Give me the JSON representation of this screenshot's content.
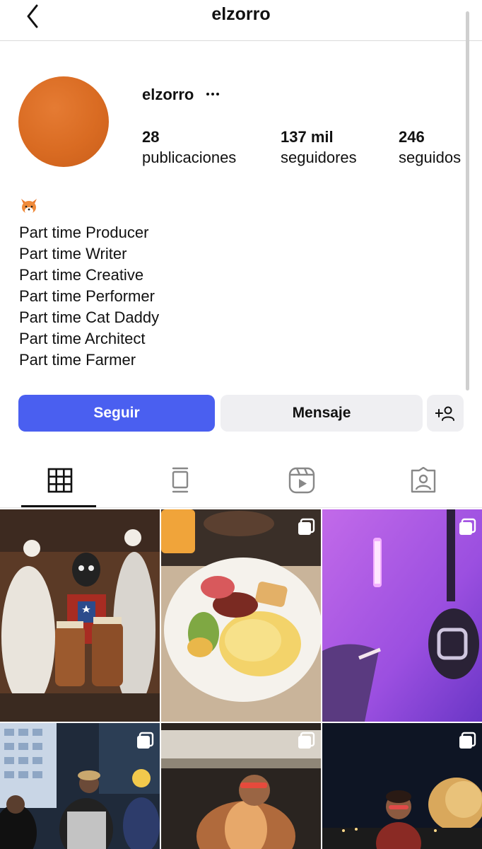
{
  "header": {
    "title": "elzorro"
  },
  "profile": {
    "username": "elzorro",
    "stats": [
      {
        "value": "28",
        "label": "publicaciones"
      },
      {
        "value": "137 mil",
        "label": "seguidores"
      },
      {
        "value": "246",
        "label": "seguidos"
      }
    ],
    "bio": {
      "emoji": "🦊",
      "lines": [
        "Part time Producer",
        "Part time Writer",
        "Part time Creative",
        "Part time Performer",
        "Part time Cat Daddy",
        "Part time Architect",
        "Part time Farmer"
      ]
    }
  },
  "actions": {
    "follow_label": "Seguir",
    "message_label": "Mensaje"
  },
  "tabs": [
    {
      "icon": "grid-icon",
      "active": true
    },
    {
      "icon": "feed-icon",
      "active": false
    },
    {
      "icon": "reels-icon",
      "active": false
    },
    {
      "icon": "tagged-icon",
      "active": false
    }
  ],
  "posts": [
    {
      "description": "painting of dancers and drummers",
      "multi": false
    },
    {
      "description": "breakfast plate",
      "multi": true
    },
    {
      "description": "purple room with guitar",
      "multi": true
    },
    {
      "description": "group photo at night",
      "multi": true
    },
    {
      "description": "man in fur coat",
      "multi": true
    },
    {
      "description": "man at night with trees",
      "multi": true
    }
  ],
  "colors": {
    "follow_button": "#4a5ff0",
    "secondary_button": "#efeff2",
    "avatar": "#d96b22"
  }
}
